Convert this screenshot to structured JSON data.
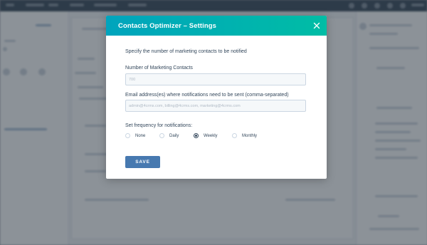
{
  "modal": {
    "title": "Contacts Optimizer – Settings",
    "intro": "Specify the number of marketing contacts to be notified",
    "contacts_field": {
      "label": "Number of Marketing Contacts",
      "value": "",
      "placeholder": "700"
    },
    "email_field": {
      "label": "Email address(es) where notifications need to be sent (comma-separated)",
      "value": "",
      "placeholder": "admin@4crms.com, billing@4crms.com, marketing@4crms.com"
    },
    "frequency": {
      "label": "Set frequency for notifications:",
      "options": [
        "None",
        "Daily",
        "Weekly",
        "Monthly"
      ],
      "selected": "Weekly"
    },
    "save_label": "SAVE"
  },
  "colors": {
    "header_gradient_start": "#00a4bd",
    "header_gradient_end": "#00bda5",
    "save_button": "#4779b0",
    "text": "#33475b",
    "topbar": "#2d3e50"
  },
  "icons": {
    "close": "close-icon"
  }
}
